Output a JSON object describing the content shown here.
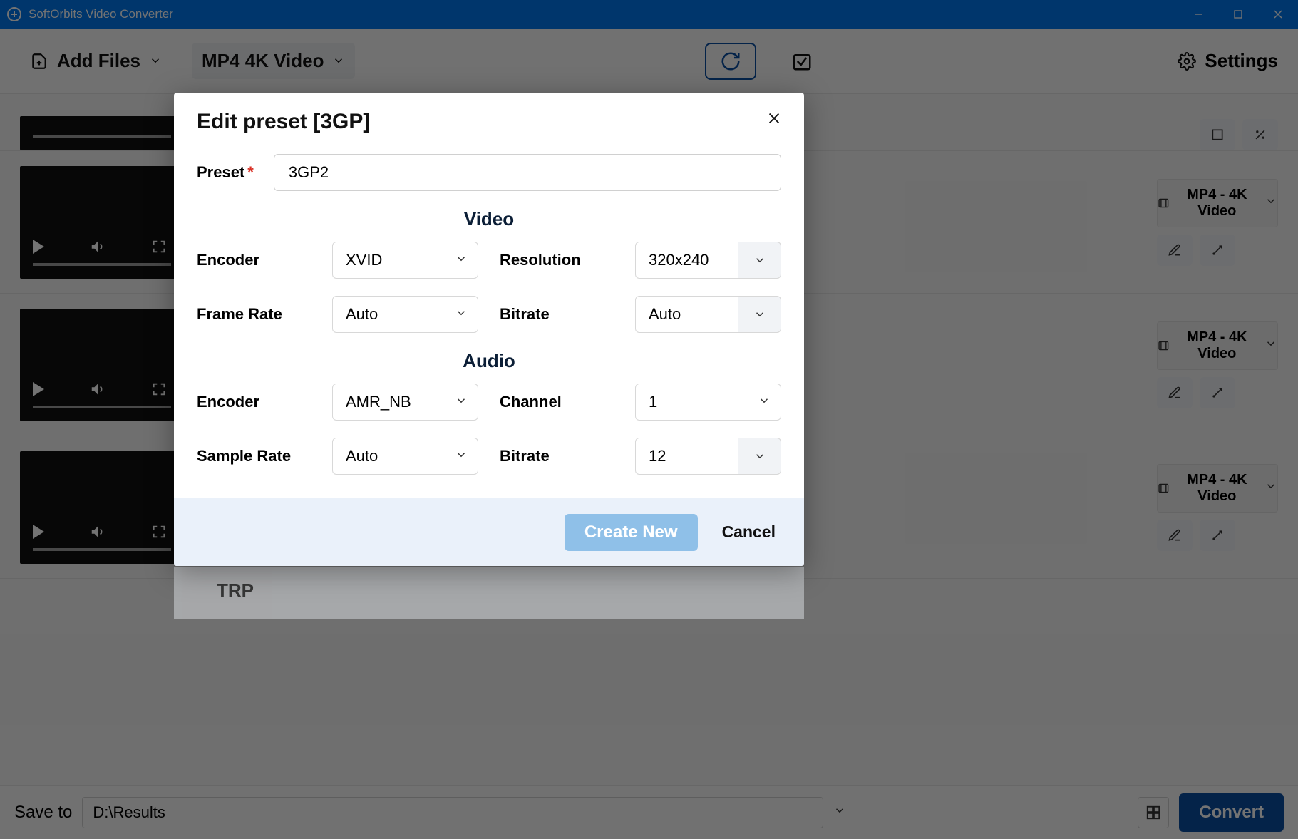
{
  "app": {
    "title": "SoftOrbits Video Converter"
  },
  "toolbar": {
    "add_files": "Add Files",
    "format_preset": "MP4 4K Video",
    "settings": "Settings"
  },
  "list": {
    "rows": [
      {
        "preset": "MP4 - 4K Video"
      },
      {
        "preset": "MP4 - 4K Video"
      },
      {
        "preset": "MP4 - 4K Video"
      }
    ]
  },
  "bottom": {
    "save_to_label": "Save to",
    "path": "D:\\Results",
    "convert_label": "Convert"
  },
  "dialog": {
    "title": "Edit preset [3GP]",
    "preset_label": "Preset",
    "preset_value": "3GP2",
    "video_section": "Video",
    "audio_section": "Audio",
    "fields": {
      "video_encoder_label": "Encoder",
      "video_encoder_value": "XVID",
      "resolution_label": "Resolution",
      "resolution_value": "320x240",
      "frame_rate_label": "Frame Rate",
      "frame_rate_value": "Auto",
      "video_bitrate_label": "Bitrate",
      "video_bitrate_value": "Auto",
      "audio_encoder_label": "Encoder",
      "audio_encoder_value": "AMR_NB",
      "channel_label": "Channel",
      "channel_value": "1",
      "sample_rate_label": "Sample Rate",
      "sample_rate_value": "Auto",
      "audio_bitrate_label": "Bitrate",
      "audio_bitrate_value": "12"
    },
    "create_label": "Create New",
    "cancel_label": "Cancel"
  },
  "leak": {
    "item": "TRP"
  }
}
